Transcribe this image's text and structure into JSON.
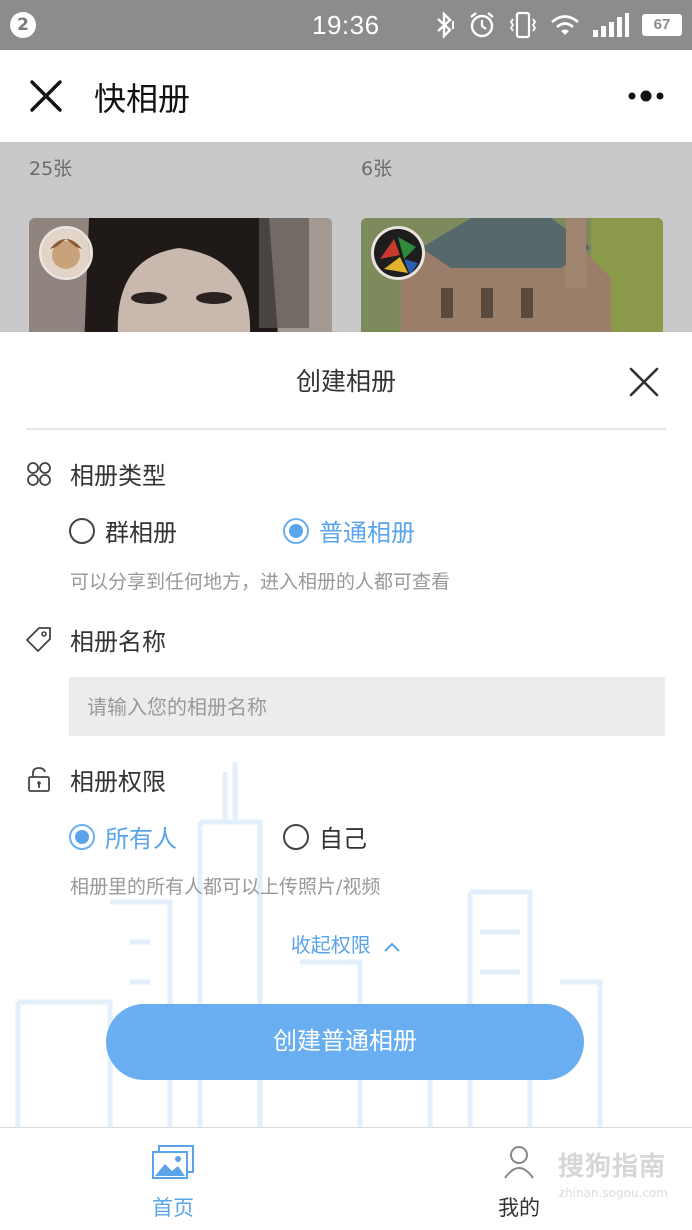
{
  "status_bar": {
    "notification_count": "2",
    "time": "19:36",
    "battery": "67",
    "icons": [
      "bluetooth-icon",
      "alarm-icon",
      "vibrate-icon",
      "wifi-icon",
      "signal-icon",
      "battery-icon"
    ]
  },
  "title_bar": {
    "title": "快相册",
    "close_icon": "close-icon",
    "more_icon": "more-icon"
  },
  "albums": [
    {
      "count": "25张"
    },
    {
      "count": "6张"
    }
  ],
  "sheet": {
    "title": "创建相册",
    "album_type": {
      "label": "相册类型",
      "icon": "grid-icon",
      "options": [
        {
          "label": "群相册",
          "selected": false
        },
        {
          "label": "普通相册",
          "selected": true
        }
      ],
      "hint": "可以分享到任何地方，进入相册的人都可查看"
    },
    "album_name": {
      "label": "相册名称",
      "icon": "tag-icon",
      "value": "",
      "placeholder": "请输入您的相册名称"
    },
    "permission": {
      "label": "相册权限",
      "icon": "lock-icon",
      "options": [
        {
          "label": "所有人",
          "selected": true
        },
        {
          "label": "自己",
          "selected": false
        }
      ],
      "hint": "相册里的所有人都可以上传照片/视频"
    },
    "collapse_label": "收起权限",
    "create_button": "创建普通相册"
  },
  "tab_bar": {
    "tabs": [
      {
        "label": "首页",
        "icon": "image-icon",
        "active": true
      },
      {
        "label": "我的",
        "icon": "user-icon",
        "active": false
      }
    ],
    "watermark": "搜狗指南",
    "watermark_sub": "zhinan.sogou.com"
  },
  "colors": {
    "accent": "#5aa4ec",
    "button": "#6aaef2",
    "status_bar": "#8c8c8c",
    "overlay": "#c9c9c9"
  }
}
